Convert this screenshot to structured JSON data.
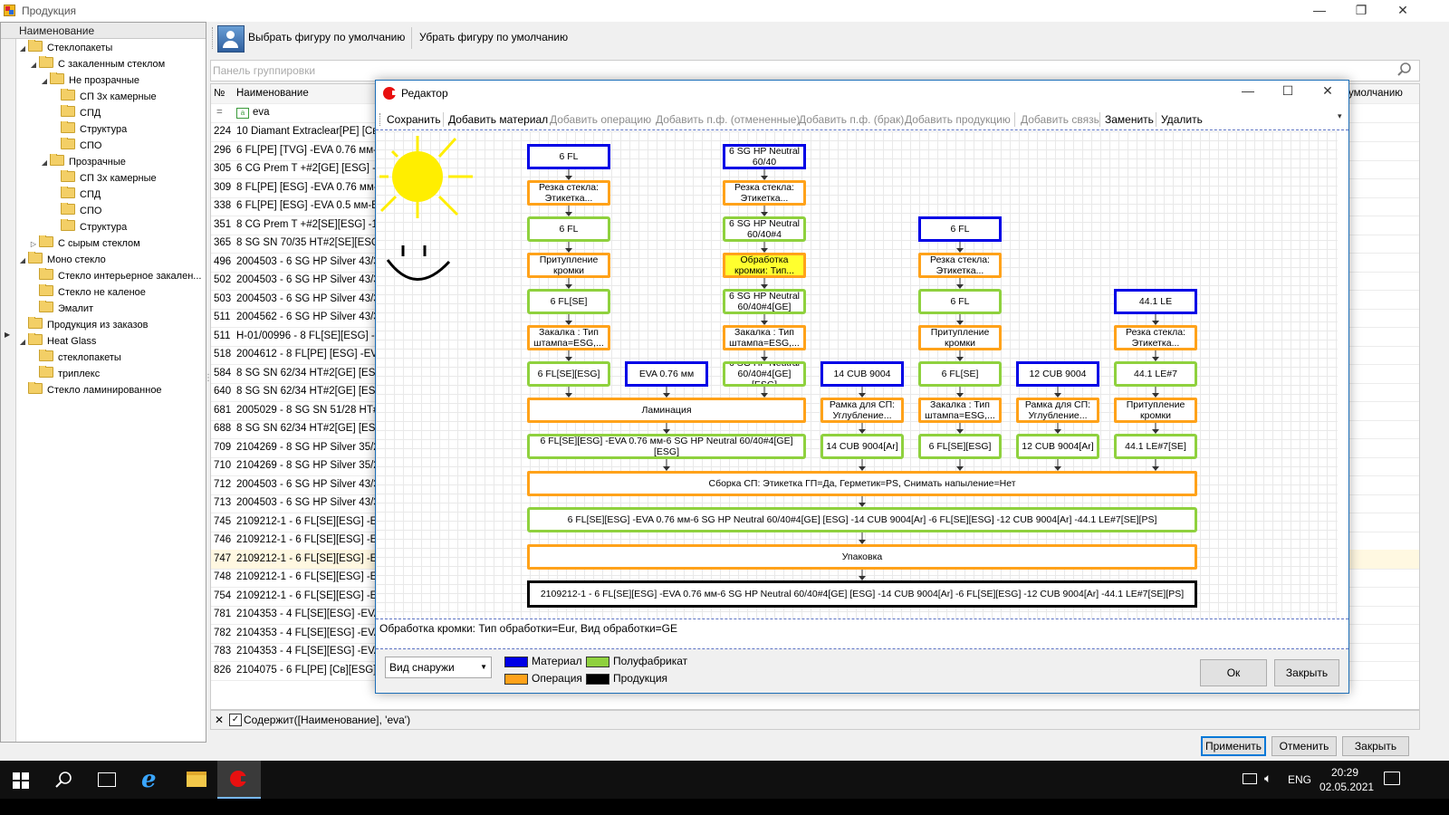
{
  "window": {
    "title": "Продукция"
  },
  "tree": {
    "header": "Наименование",
    "nodes": [
      {
        "label": "Стеклопакеты",
        "level": 0,
        "arrow": "◢"
      },
      {
        "label": "С закаленным стеклом",
        "level": 1,
        "arrow": "◢"
      },
      {
        "label": "Не прозрачные",
        "level": 2,
        "arrow": "◢"
      },
      {
        "label": "СП 3х камерные",
        "level": 3,
        "arrow": ""
      },
      {
        "label": "СПД",
        "level": 3,
        "arrow": ""
      },
      {
        "label": "Структура",
        "level": 3,
        "arrow": ""
      },
      {
        "label": "СПО",
        "level": 3,
        "arrow": ""
      },
      {
        "label": "Прозрачные",
        "level": 2,
        "arrow": "◢"
      },
      {
        "label": "СП 3х камерные",
        "level": 3,
        "arrow": ""
      },
      {
        "label": "СПД",
        "level": 3,
        "arrow": ""
      },
      {
        "label": "СПО",
        "level": 3,
        "arrow": ""
      },
      {
        "label": "Структура",
        "level": 3,
        "arrow": ""
      },
      {
        "label": "С сырым стеклом",
        "level": 1,
        "arrow": "▷"
      },
      {
        "label": "Моно стекло",
        "level": 0,
        "arrow": "◢"
      },
      {
        "label": "Стекло интерьерное закален...",
        "level": 1,
        "arrow": ""
      },
      {
        "label": "Стекло не каленое",
        "level": 1,
        "arrow": ""
      },
      {
        "label": "Эмалит",
        "level": 1,
        "arrow": ""
      },
      {
        "label": "Продукция из заказов",
        "level": 0,
        "arrow": ""
      },
      {
        "label": "Heat Glass",
        "level": 0,
        "arrow": "◢"
      },
      {
        "label": "стеклопакеты",
        "level": 1,
        "arrow": ""
      },
      {
        "label": "триплекс",
        "level": 1,
        "arrow": ""
      },
      {
        "label": "Стекло ламинированное",
        "level": 0,
        "arrow": ""
      }
    ]
  },
  "toolbar": {
    "select_default": "Выбрать фигуру по умолчанию",
    "remove_default": "Убрать фигуру по умолчанию"
  },
  "group_panel": "Панель группировки",
  "grid": {
    "col_no": "№",
    "col_name": "Наименование",
    "col_right": "умолчанию",
    "filter_value": "eva",
    "rows": [
      {
        "no": "224",
        "name": "10 Diamant Extraclear[PE] [Св][Е"
      },
      {
        "no": "296",
        "name": "6 FL[PE] [TVG] -EVA 0.76 мм-6 FL"
      },
      {
        "no": "305",
        "name": "6 CG Prem T +#2[GE] [ESG] -16["
      },
      {
        "no": "309",
        "name": "8 FL[PE] [ESG] -EVA 0.76 мм-EVA"
      },
      {
        "no": "338",
        "name": "6 FL[PE] [ESG] -EVA 0.5 мм-EVA"
      },
      {
        "no": "351",
        "name": "8 CG Prem T +#2[SE][ESG] -14["
      },
      {
        "no": "365",
        "name": "8 SG SN 70/35 HT#2[SE][ESG] -"
      },
      {
        "no": "496",
        "name": "2004503 - 6 SG HP Silver 43/31#"
      },
      {
        "no": "502",
        "name": "2004503 - 6 SG HP Silver 43/31#"
      },
      {
        "no": "503",
        "name": "2004503 - 6 SG HP Silver 43/31#"
      },
      {
        "no": "511",
        "name": "2004562 - 6 SG HP Silver 43/31#"
      },
      {
        "no": "511",
        "name": "H-01/00996 - 8 FL[SE][ESG] -18-"
      },
      {
        "no": "518",
        "name": "2004612 - 8 FL[PE] [ESG] -EVA 0"
      },
      {
        "no": "584",
        "name": "8 SG SN 62/34 HT#2[GE] [ESG] -"
      },
      {
        "no": "640",
        "name": "8 SG SN 62/34 HT#2[GE] [ESG] -"
      },
      {
        "no": "681",
        "name": "2005029 - 8 SG SN 51/28 HT#2["
      },
      {
        "no": "688",
        "name": "8 SG SN 62/34 HT#2[GE] [ESG] -"
      },
      {
        "no": "709",
        "name": "2104269 - 8 SG HP Silver 35/26#"
      },
      {
        "no": "710",
        "name": "2104269 - 8 SG HP Silver 35/26#"
      },
      {
        "no": "712",
        "name": "2004503 - 6 SG HP Silver 43/31#"
      },
      {
        "no": "713",
        "name": "2004503 - 6 SG HP Silver 43/31#"
      },
      {
        "no": "745",
        "name": "2109212-1 - 6 FL[SE][ESG] -EVA"
      },
      {
        "no": "746",
        "name": "2109212-1 - 6 FL[SE][ESG] -EVA"
      },
      {
        "no": "747",
        "name": "2109212-1 - 6 FL[SE][ESG] -EVA"
      },
      {
        "no": "748",
        "name": "2109212-1 - 6 FL[SE][ESG] -EVA"
      },
      {
        "no": "754",
        "name": "2109212-1 - 6 FL[SE][ESG] -EVA"
      },
      {
        "no": "781",
        "name": "2104353 - 4 FL[SE][ESG] -EVA 0."
      },
      {
        "no": "782",
        "name": "2104353 - 4 FL[SE][ESG] -EVA 0."
      },
      {
        "no": "783",
        "name": "2104353 - 4 FL[SE][ESG] -EVA 0."
      },
      {
        "no": "826",
        "name": "2104075 - 6 FL[PE] [Св][ESG] -E"
      }
    ]
  },
  "filter_text": "Содержит([Наименование], 'eva')",
  "bottom_buttons": {
    "apply": "Применить",
    "cancel": "Отменить",
    "close": "Закрыть"
  },
  "editor": {
    "title": "Редактор",
    "toolbar": {
      "save": "Сохранить",
      "add_material": "Добавить материал",
      "add_operation": "Добавить операцию",
      "add_pf_cancelled": "Добавить п.ф. (отмененные)",
      "add_pf_defect": "Добавить п.ф. (брак)",
      "add_product": "Добавить продукцию",
      "add_link": "Добавить связь",
      "replace": "Заменить",
      "delete": "Удалить"
    },
    "status": "Обработка кромки: Тип обработки=Eur, Вид обработки=GE",
    "view_select": "Вид снаружи",
    "legend": [
      {
        "label": "Материал",
        "color": "#0000e6"
      },
      {
        "label": "Полуфабрикат",
        "color": "#8fd13e"
      },
      {
        "label": "Операция",
        "color": "#ffa21a"
      },
      {
        "label": "Продукция",
        "color": "#000000"
      }
    ],
    "ok": "Ок",
    "close": "Закрыть",
    "nodes": [
      {
        "id": "a1",
        "kind": "m",
        "text": "6 FL"
      },
      {
        "id": "a2",
        "kind": "o",
        "text": "Резка стекла: Этикетка..."
      },
      {
        "id": "a3",
        "kind": "p",
        "text": "6 FL"
      },
      {
        "id": "a4",
        "kind": "o",
        "text": "Притупление кромки"
      },
      {
        "id": "a5",
        "kind": "p",
        "text": "6 FL[SE]"
      },
      {
        "id": "a6",
        "kind": "o",
        "text": "Закалка : Тип штампа=ESG,..."
      },
      {
        "id": "a7",
        "kind": "p",
        "text": "6 FL[SE][ESG]"
      },
      {
        "id": "e1",
        "kind": "m",
        "text": "EVA 0.76 мм"
      },
      {
        "id": "b1",
        "kind": "m",
        "text": "6 SG HP Neutral 60/40"
      },
      {
        "id": "b2",
        "kind": "o",
        "text": "Резка стекла: Этикетка..."
      },
      {
        "id": "b3",
        "kind": "p",
        "text": "6 SG HP Neutral 60/40#4"
      },
      {
        "id": "b4",
        "kind": "o",
        "text": "Обработка кромки: Тип...",
        "highlight": true
      },
      {
        "id": "b5",
        "kind": "p",
        "text": "6 SG HP Neutral 60/40#4[GE]"
      },
      {
        "id": "b6",
        "kind": "o",
        "text": "Закалка : Тип штампа=ESG,..."
      },
      {
        "id": "b7",
        "kind": "p",
        "text": "6 SG HP Neutral 60/40#4[GE] [ESG]"
      },
      {
        "id": "lam",
        "kind": "o",
        "text": "Ламинация"
      },
      {
        "id": "lamp",
        "kind": "p",
        "text": "6 FL[SE][ESG] -EVA 0.76 мм-6 SG HP Neutral 60/40#4[GE] [ESG]"
      },
      {
        "id": "c1",
        "kind": "m",
        "text": "14 CUB 9004"
      },
      {
        "id": "c2",
        "kind": "o",
        "text": "Рамка для СП: Углубление..."
      },
      {
        "id": "c3",
        "kind": "p",
        "text": "14 CUB 9004[Ar]"
      },
      {
        "id": "d1",
        "kind": "m",
        "text": "6 FL"
      },
      {
        "id": "d2",
        "kind": "o",
        "text": "Резка стекла: Этикетка..."
      },
      {
        "id": "d3",
        "kind": "p",
        "text": "6 FL"
      },
      {
        "id": "d4",
        "kind": "o",
        "text": "Притупление кромки"
      },
      {
        "id": "d5",
        "kind": "p",
        "text": "6 FL[SE]"
      },
      {
        "id": "d6",
        "kind": "o",
        "text": "Закалка : Тип штампа=ESG,..."
      },
      {
        "id": "d7",
        "kind": "p",
        "text": "6 FL[SE][ESG]"
      },
      {
        "id": "f1",
        "kind": "m",
        "text": "12 CUB 9004"
      },
      {
        "id": "f2",
        "kind": "o",
        "text": "Рамка для СП: Углубление..."
      },
      {
        "id": "f3",
        "kind": "p",
        "text": "12 CUB 9004[Ar]"
      },
      {
        "id": "g1",
        "kind": "m",
        "text": "44.1 LE"
      },
      {
        "id": "g2",
        "kind": "o",
        "text": "Резка стекла: Этикетка..."
      },
      {
        "id": "g3",
        "kind": "p",
        "text": "44.1 LE#7"
      },
      {
        "id": "g4",
        "kind": "o",
        "text": "Притупление кромки"
      },
      {
        "id": "g5",
        "kind": "p",
        "text": "44.1 LE#7[SE]"
      },
      {
        "id": "asm",
        "kind": "o",
        "text": "Сборка СП: Этикетка ГП=Да, Герметик=PS, Снимать напыление=Нет"
      },
      {
        "id": "asmp",
        "kind": "p",
        "text": "6 FL[SE][ESG] -EVA 0.76 мм-6 SG HP Neutral 60/40#4[GE] [ESG] -14 CUB 9004[Ar] -6 FL[SE][ESG] -12 CUB 9004[Ar] -44.1 LE#7[SE][PS]"
      },
      {
        "id": "pack",
        "kind": "o",
        "text": "Упаковка"
      },
      {
        "id": "prod",
        "kind": "r",
        "text": "2109212-1 - 6 FL[SE][ESG] -EVA 0.76 мм-6 SG HP Neutral 60/40#4[GE] [ESG] -14 CUB 9004[Ar] -6 FL[SE][ESG] -12 CUB 9004[Ar] -44.1 LE#7[SE][PS]"
      }
    ]
  },
  "taskbar": {
    "lang": "ENG",
    "time": "20:29",
    "date": "02.05.2021"
  }
}
